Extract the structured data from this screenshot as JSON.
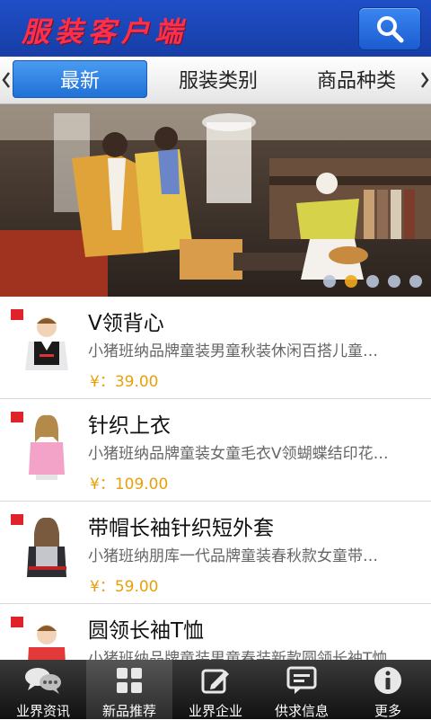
{
  "header": {
    "title": "服装客户端",
    "search_icon": "search-icon"
  },
  "tabs": [
    {
      "label": "最新",
      "active": true
    },
    {
      "label": "服装类别",
      "active": false
    },
    {
      "label": "商品种类",
      "active": false
    }
  ],
  "banner": {
    "slide_count": 5,
    "active_slide": 2
  },
  "products": [
    {
      "title": "V领背心",
      "desc": "小猪班纳品牌童装男童秋装休闲百搭儿童…",
      "price": "¥：39.00"
    },
    {
      "title": "针织上衣",
      "desc": "小猪班纳品牌童装女童毛衣V领蝴蝶结印花…",
      "price": "¥：109.00"
    },
    {
      "title": "带帽长袖针织短外套",
      "desc": "小猪班纳朋库一代品牌童装春秋款女童带…",
      "price": "¥：59.00"
    },
    {
      "title": "圆领长袖T恤",
      "desc": "小猪班纳品牌童装男童春装新款圆领长袖T恤",
      "price": ""
    }
  ],
  "bottom_nav": [
    {
      "label": "业界资讯",
      "icon": "chat-bubbles-icon",
      "active": false
    },
    {
      "label": "新品推荐",
      "icon": "grid-icon",
      "active": true
    },
    {
      "label": "业界企业",
      "icon": "edit-icon",
      "active": false
    },
    {
      "label": "供求信息",
      "icon": "message-icon",
      "active": false
    },
    {
      "label": "更多",
      "icon": "info-icon",
      "active": false
    }
  ]
}
